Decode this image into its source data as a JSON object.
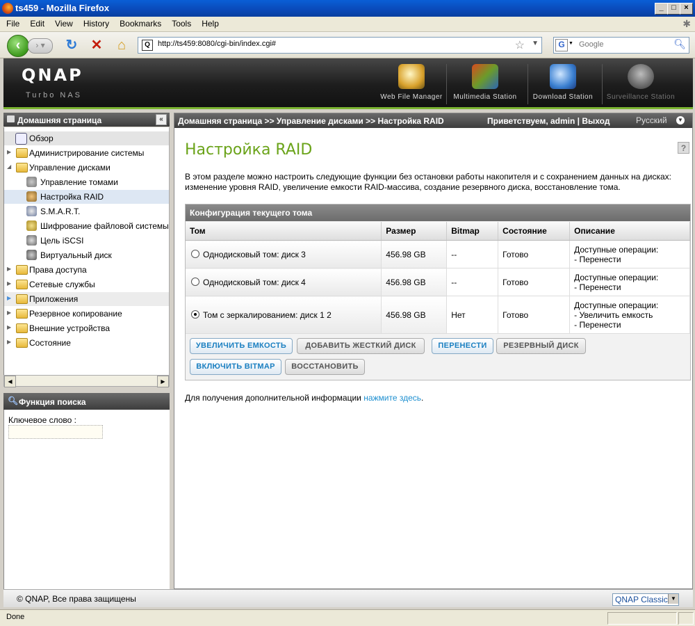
{
  "window": {
    "title": "ts459 - Mozilla Firefox"
  },
  "menu": {
    "items": [
      "File",
      "Edit",
      "View",
      "History",
      "Bookmarks",
      "Tools",
      "Help"
    ]
  },
  "nav": {
    "url": "http://ts459:8080/cgi-bin/index.cgi#",
    "search_placeholder": "Google"
  },
  "header": {
    "logo": "QNAP",
    "subtitle": "Turbo NAS",
    "apps": [
      "Web File Manager",
      "Multimedia Station",
      "Download Station",
      "Surveillance Station"
    ]
  },
  "sidebar": {
    "title": "Домашняя страница",
    "items": [
      {
        "label": "Обзор"
      },
      {
        "label": "Администрирование системы"
      },
      {
        "label": "Управление дисками"
      },
      {
        "label": "Управление томами"
      },
      {
        "label": "Настройка RAID"
      },
      {
        "label": "S.M.A.R.T."
      },
      {
        "label": "Шифрование файловой системы"
      },
      {
        "label": "Цель iSCSI"
      },
      {
        "label": "Виртуальный диск"
      },
      {
        "label": "Права доступа"
      },
      {
        "label": "Сетевые службы"
      },
      {
        "label": "Приложения"
      },
      {
        "label": "Резервное копирование"
      },
      {
        "label": "Внешние устройства"
      },
      {
        "label": "Состояние"
      }
    ]
  },
  "search_panel": {
    "title": "Функция поиска",
    "keyword_label": "Ключевое слово :",
    "keyword_value": ""
  },
  "breadcrumb": {
    "path": "Домашняя страница >> Управление дисками >> Настройка RAID",
    "welcome": "Приветствуем,",
    "user": "admin",
    "logout": "Выход",
    "language": "Русский"
  },
  "main": {
    "title": "Настройка RAID",
    "intro": "В этом разделе можно настроить следующие функции без остановки работы накопителя и с сохранением данных на дисках: изменение уровня RAID, увеличение емкости RAID-массива, создание резервного диска, восстановление тома.",
    "config_title": "Конфигурация текущего тома",
    "columns": [
      "Том",
      "Размер",
      "Bitmap",
      "Состояние",
      "Описание"
    ],
    "rows": [
      {
        "volume": "Однодисковый том: диск 3",
        "size": "456.98 GB",
        "bitmap": "--",
        "status": "Готово",
        "desc_title": "Доступные операции:",
        "ops": [
          "- Перенести"
        ]
      },
      {
        "volume": "Однодисковый том: диск 4",
        "size": "456.98 GB",
        "bitmap": "--",
        "status": "Готово",
        "desc_title": "Доступные операции:",
        "ops": [
          "- Перенести"
        ]
      },
      {
        "volume": "Том с зеркалированием: диск 1 2",
        "size": "456.98 GB",
        "bitmap": "Нет",
        "status": "Готово",
        "desc_title": "Доступные операции:",
        "ops": [
          "- Увеличить емкость",
          "- Перенести"
        ]
      }
    ],
    "buttons": {
      "expand": "УВЕЛИЧИТЬ ЕМКОСТЬ",
      "add_disk": "ДОБАВИТЬ ЖЕСТКИЙ ДИСК",
      "migrate": "ПЕРЕНЕСТИ",
      "spare": "РЕЗЕРВНЫЙ ДИСК",
      "bitmap": "ВКЛЮЧИТЬ BITMAP",
      "recover": "ВОССТАНОВИТЬ"
    },
    "more_info": "Для получения дополнительной информации",
    "more_info_link": "нажмите здесь",
    "more_info_end": "."
  },
  "footer": {
    "copyright": "© QNAP, Все права защищены",
    "theme": "QNAP Classic"
  },
  "status": {
    "text": "Done"
  }
}
